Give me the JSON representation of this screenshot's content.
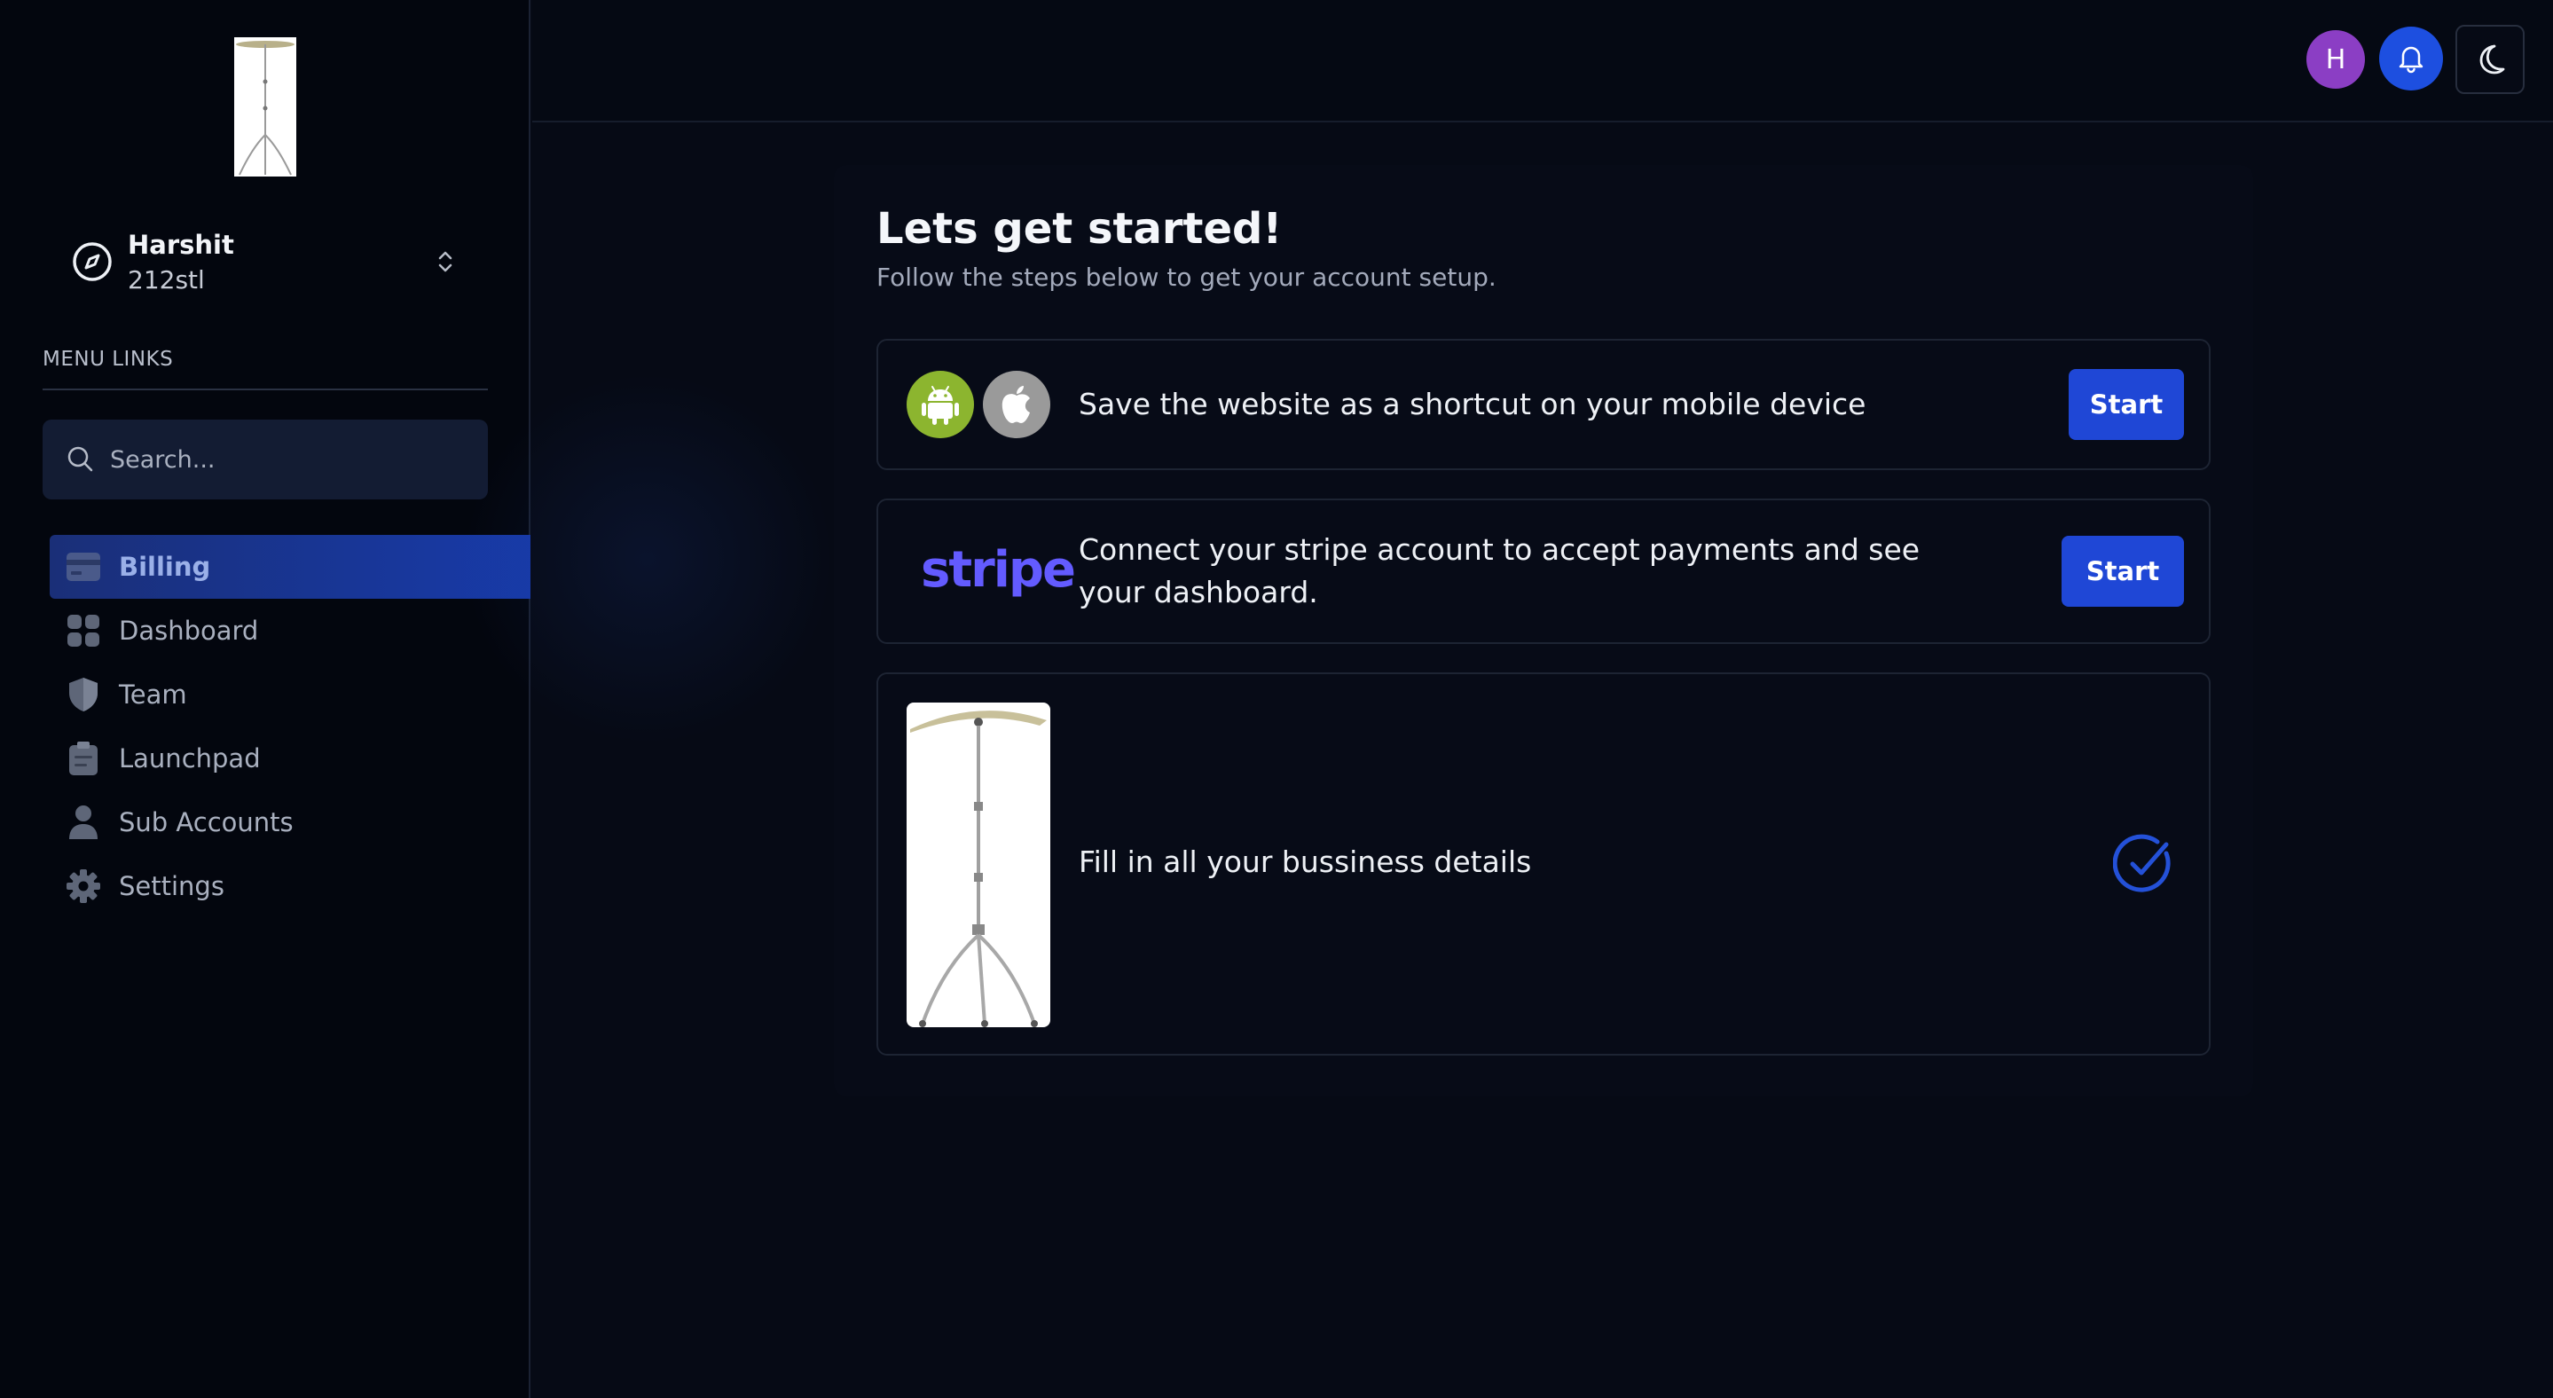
{
  "sidebar": {
    "account": {
      "name": "Harshit",
      "subtitle": "212stl"
    },
    "menu_title": "MENU LINKS",
    "search_placeholder": "Search...",
    "items": [
      {
        "label": "Billing",
        "icon": "credit-card-icon",
        "active": true
      },
      {
        "label": "Dashboard",
        "icon": "grid-icon",
        "active": false
      },
      {
        "label": "Team",
        "icon": "shield-icon",
        "active": false
      },
      {
        "label": "Launchpad",
        "icon": "clipboard-icon",
        "active": false
      },
      {
        "label": "Sub Accounts",
        "icon": "person-icon",
        "active": false
      },
      {
        "label": "Settings",
        "icon": "gear-icon",
        "active": false
      }
    ]
  },
  "header": {
    "avatar_initial": "H"
  },
  "main": {
    "title": "Lets get started!",
    "subtitle": "Follow the steps below to get your account setup.",
    "steps": [
      {
        "text": "Save the website as a shortcut on your mobile device",
        "button": "Start",
        "completed": false
      },
      {
        "text": "Connect your stripe account to accept payments and see your dashboard.",
        "logo_text": "stripe",
        "button": "Start",
        "completed": false
      },
      {
        "text": "Fill in all your bussiness details",
        "completed": true
      }
    ]
  },
  "colors": {
    "accent": "#1f47d6",
    "avatar": "#8b3ec4",
    "stripe": "#635bff",
    "android": "#8cb52f",
    "apple": "#9a9a9a"
  }
}
